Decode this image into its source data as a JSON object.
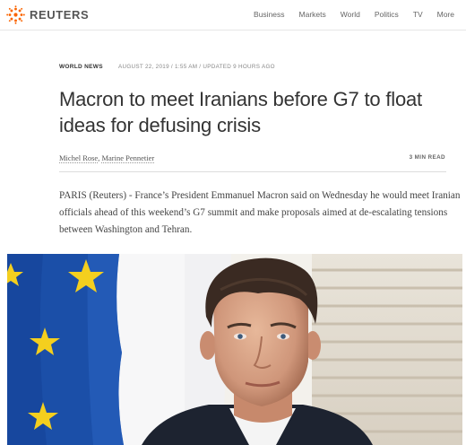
{
  "brand": {
    "name": "REUTERS",
    "colors": {
      "accent": "#fa6400",
      "text": "#333333"
    }
  },
  "nav": {
    "items": [
      {
        "label": "Business"
      },
      {
        "label": "Markets"
      },
      {
        "label": "World"
      },
      {
        "label": "Politics"
      },
      {
        "label": "TV"
      },
      {
        "label": "More"
      }
    ]
  },
  "article": {
    "section": "WORLD NEWS",
    "dateline": "AUGUST 22, 2019 / 1:55 AM / UPDATED 9 HOURS AGO",
    "headline": "Macron to meet Iranians before G7 to float ideas for defusing crisis",
    "authors": [
      "Michel Rose",
      "Marine Pennetier"
    ],
    "author_separator": ", ",
    "read_time": "3 MIN READ",
    "lead": "PARIS (Reuters) - France’s President Emmanuel Macron said on Wednesday he would meet Iranian officials ahead of this weekend’s G7 summit and make proposals aimed at de-escalating tensions between Washington and Tehran.",
    "photo_icon": "portrait-photo-eu-flag"
  }
}
